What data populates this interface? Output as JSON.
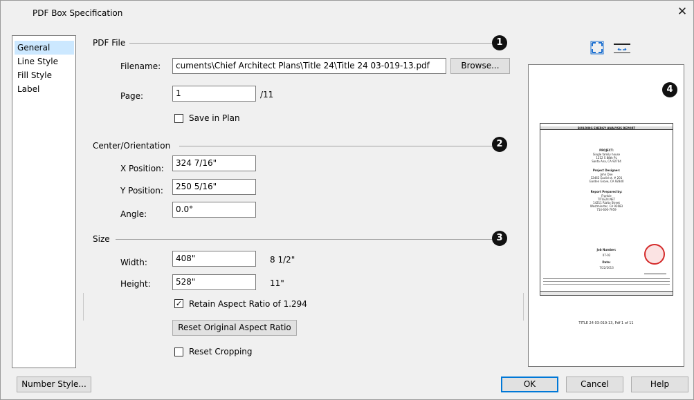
{
  "dialog": {
    "title": "PDF Box Specification",
    "close_glyph": "✕"
  },
  "nav": {
    "items": [
      {
        "label": "General",
        "selected": true
      },
      {
        "label": "Line Style",
        "selected": false
      },
      {
        "label": "Fill Style",
        "selected": false
      },
      {
        "label": "Label",
        "selected": false
      }
    ]
  },
  "pdf_file": {
    "section_label": "PDF File",
    "filename_label": "Filename:",
    "filename_value": "cuments\\Chief Architect Plans\\Title 24\\Title 24 03-019-13.pdf",
    "browse_label": "Browse...",
    "page_label": "Page:",
    "page_value": "1",
    "page_total": "/11",
    "save_in_plan_label": "Save in Plan",
    "save_in_plan_checked": false
  },
  "center": {
    "section_label": "Center/Orientation",
    "x_label": "X Position:",
    "x_value": "324 7/16\"",
    "y_label": "Y Position:",
    "y_value": "250 5/16\"",
    "angle_label": "Angle:",
    "angle_value": "0.0°"
  },
  "size": {
    "section_label": "Size",
    "width_label": "Width:",
    "width_value": "408\"",
    "width_original": "8 1/2\"",
    "height_label": "Height:",
    "height_value": "528\"",
    "height_original": "11\"",
    "retain_label": "Retain Aspect Ratio of 1.294",
    "retain_checked": true,
    "reset_ratio_label": "Reset Original Aspect Ratio",
    "reset_cropping_label": "Reset Cropping",
    "reset_cropping_checked": false
  },
  "callouts": [
    "1",
    "2",
    "3",
    "4"
  ],
  "preview": {
    "fill_icon": "fill-window-icon",
    "fit_width_icon": "fit-width-icon",
    "doc_header": "BUILDING ENERGY ANALYSIS REPORT",
    "project_label": "PROJECT:",
    "project_lines": [
      "Single family house",
      "1212 S 88th PL",
      "Santa Ana, CA 92704"
    ],
    "designer_label": "Project Designer:",
    "designer_lines": [
      "John Doe",
      "12462 Euclid st. # 201",
      "Garden Grove, CA 92840"
    ],
    "prepared_label": "Report Prepared by:",
    "prepared_lines": [
      "Frankie",
      "TITLE24.NET",
      "14211 Rialto Street",
      "Westminster, CA 92683",
      "714-600-7959"
    ],
    "job_label": "Job Number:",
    "job_value": "07-02",
    "date_label": "Date:",
    "date_value": "7/22/2013",
    "footer_text": "TITLE 24 03-019-13, Pdf 1 of 11"
  },
  "footer": {
    "number_style_label": "Number Style...",
    "ok_label": "OK",
    "cancel_label": "Cancel",
    "help_label": "Help"
  },
  "colors": {
    "dialog_bg": "#f0f0f0",
    "selection": "#cce8ff",
    "default_button_border": "#0078d7",
    "badge": "#111111",
    "seal": "#d42a2a"
  }
}
